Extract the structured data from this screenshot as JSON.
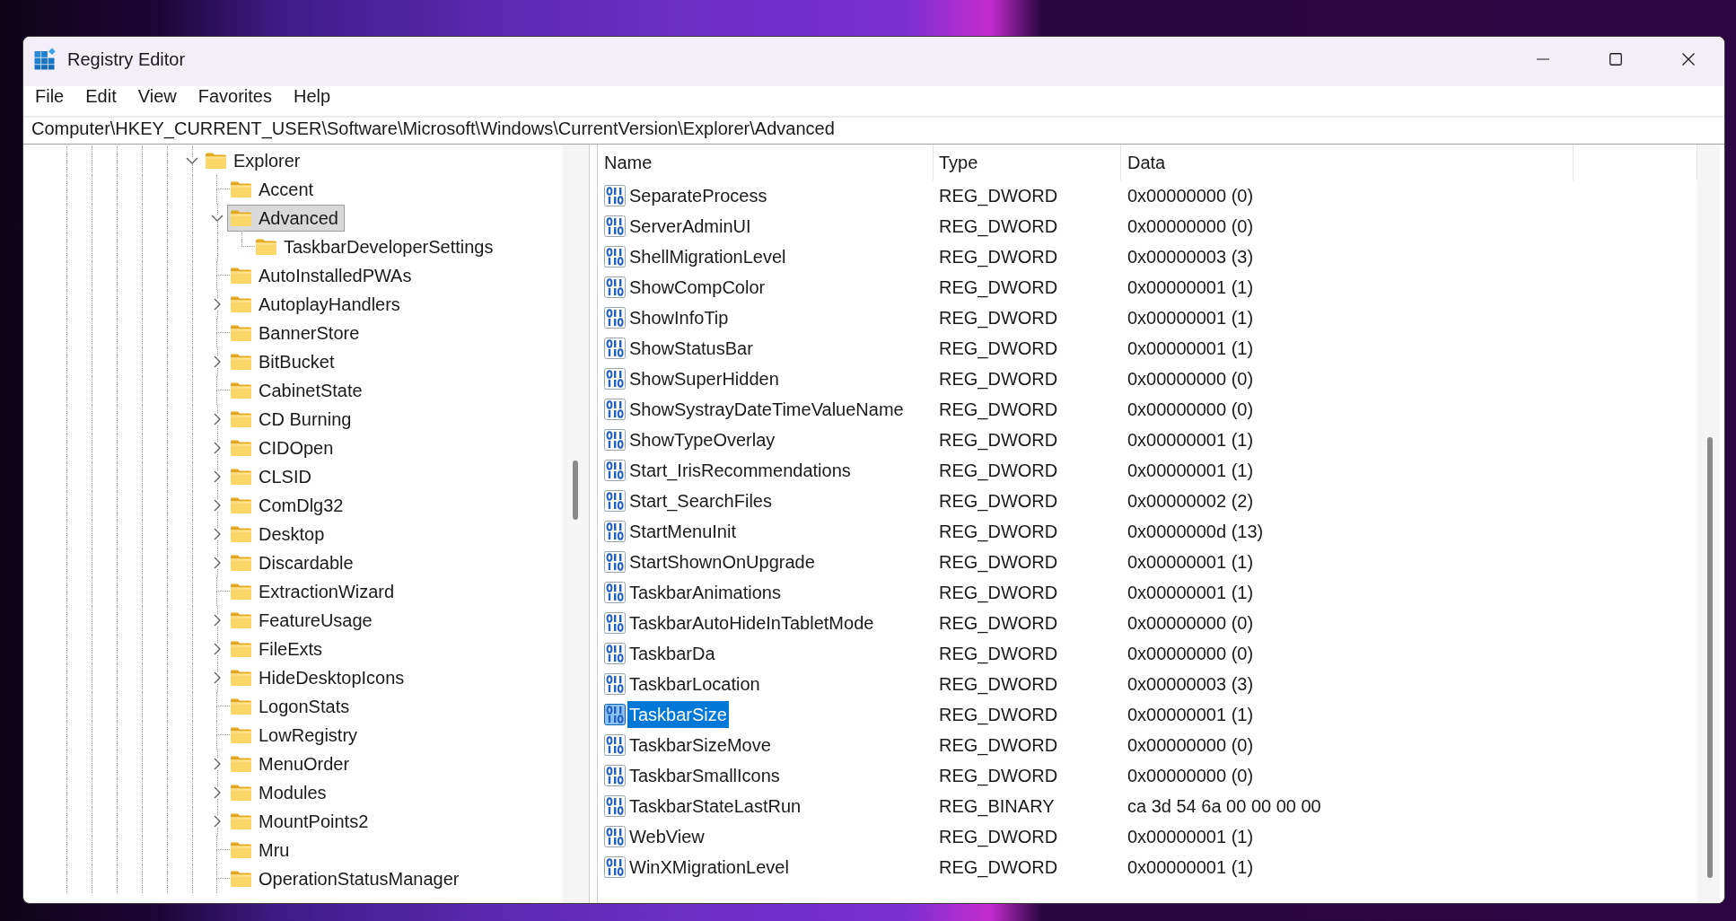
{
  "window": {
    "title": "Registry Editor"
  },
  "menu": [
    "File",
    "Edit",
    "View",
    "Favorites",
    "Help"
  ],
  "address_bar": {
    "value": "Computer\\HKEY_CURRENT_USER\\Software\\Microsoft\\Windows\\CurrentVersion\\Explorer\\Advanced"
  },
  "tree": {
    "items": [
      {
        "label": "Explorer",
        "kind": "branch",
        "expanded": true,
        "selected": false,
        "children": [
          {
            "label": "Accent",
            "kind": "leaf",
            "expanded": false,
            "selected": false
          },
          {
            "label": "Advanced",
            "kind": "branch",
            "expanded": true,
            "selected": true,
            "children": [
              {
                "label": "TaskbarDeveloperSettings",
                "kind": "leaf",
                "expanded": false,
                "selected": false
              }
            ]
          },
          {
            "label": "AutoInstalledPWAs",
            "kind": "leaf",
            "expanded": false,
            "selected": false
          },
          {
            "label": "AutoplayHandlers",
            "kind": "branch",
            "expanded": false,
            "selected": false
          },
          {
            "label": "BannerStore",
            "kind": "leaf",
            "expanded": false,
            "selected": false
          },
          {
            "label": "BitBucket",
            "kind": "branch",
            "expanded": false,
            "selected": false
          },
          {
            "label": "CabinetState",
            "kind": "leaf",
            "expanded": false,
            "selected": false
          },
          {
            "label": "CD Burning",
            "kind": "branch",
            "expanded": false,
            "selected": false
          },
          {
            "label": "CIDOpen",
            "kind": "branch",
            "expanded": false,
            "selected": false
          },
          {
            "label": "CLSID",
            "kind": "branch",
            "expanded": false,
            "selected": false
          },
          {
            "label": "ComDlg32",
            "kind": "branch",
            "expanded": false,
            "selected": false
          },
          {
            "label": "Desktop",
            "kind": "branch",
            "expanded": false,
            "selected": false
          },
          {
            "label": "Discardable",
            "kind": "branch",
            "expanded": false,
            "selected": false
          },
          {
            "label": "ExtractionWizard",
            "kind": "leaf",
            "expanded": false,
            "selected": false
          },
          {
            "label": "FeatureUsage",
            "kind": "branch",
            "expanded": false,
            "selected": false
          },
          {
            "label": "FileExts",
            "kind": "branch",
            "expanded": false,
            "selected": false
          },
          {
            "label": "HideDesktopIcons",
            "kind": "branch",
            "expanded": false,
            "selected": false
          },
          {
            "label": "LogonStats",
            "kind": "leaf",
            "expanded": false,
            "selected": false
          },
          {
            "label": "LowRegistry",
            "kind": "leaf",
            "expanded": false,
            "selected": false
          },
          {
            "label": "MenuOrder",
            "kind": "branch",
            "expanded": false,
            "selected": false
          },
          {
            "label": "Modules",
            "kind": "branch",
            "expanded": false,
            "selected": false
          },
          {
            "label": "MountPoints2",
            "kind": "branch",
            "expanded": false,
            "selected": false
          },
          {
            "label": "Mru",
            "kind": "leaf",
            "expanded": false,
            "selected": false
          },
          {
            "label": "OperationStatusManager",
            "kind": "leaf",
            "expanded": false,
            "selected": false
          }
        ]
      }
    ]
  },
  "values_table": {
    "columns": [
      "Name",
      "Type",
      "Data"
    ],
    "rows": [
      {
        "name": "SeparateProcess",
        "type": "REG_DWORD",
        "data": "0x00000000 (0)",
        "selected": false
      },
      {
        "name": "ServerAdminUI",
        "type": "REG_DWORD",
        "data": "0x00000000 (0)",
        "selected": false
      },
      {
        "name": "ShellMigrationLevel",
        "type": "REG_DWORD",
        "data": "0x00000003 (3)",
        "selected": false
      },
      {
        "name": "ShowCompColor",
        "type": "REG_DWORD",
        "data": "0x00000001 (1)",
        "selected": false
      },
      {
        "name": "ShowInfoTip",
        "type": "REG_DWORD",
        "data": "0x00000001 (1)",
        "selected": false
      },
      {
        "name": "ShowStatusBar",
        "type": "REG_DWORD",
        "data": "0x00000001 (1)",
        "selected": false
      },
      {
        "name": "ShowSuperHidden",
        "type": "REG_DWORD",
        "data": "0x00000000 (0)",
        "selected": false
      },
      {
        "name": "ShowSystrayDateTimeValueName",
        "type": "REG_DWORD",
        "data": "0x00000000 (0)",
        "selected": false
      },
      {
        "name": "ShowTypeOverlay",
        "type": "REG_DWORD",
        "data": "0x00000001 (1)",
        "selected": false
      },
      {
        "name": "Start_IrisRecommendations",
        "type": "REG_DWORD",
        "data": "0x00000001 (1)",
        "selected": false
      },
      {
        "name": "Start_SearchFiles",
        "type": "REG_DWORD",
        "data": "0x00000002 (2)",
        "selected": false
      },
      {
        "name": "StartMenuInit",
        "type": "REG_DWORD",
        "data": "0x0000000d (13)",
        "selected": false
      },
      {
        "name": "StartShownOnUpgrade",
        "type": "REG_DWORD",
        "data": "0x00000001 (1)",
        "selected": false
      },
      {
        "name": "TaskbarAnimations",
        "type": "REG_DWORD",
        "data": "0x00000001 (1)",
        "selected": false
      },
      {
        "name": "TaskbarAutoHideInTabletMode",
        "type": "REG_DWORD",
        "data": "0x00000000 (0)",
        "selected": false
      },
      {
        "name": "TaskbarDa",
        "type": "REG_DWORD",
        "data": "0x00000000 (0)",
        "selected": false
      },
      {
        "name": "TaskbarLocation",
        "type": "REG_DWORD",
        "data": "0x00000003 (3)",
        "selected": false
      },
      {
        "name": "TaskbarSize",
        "type": "REG_DWORD",
        "data": "0x00000001 (1)",
        "selected": true
      },
      {
        "name": "TaskbarSizeMove",
        "type": "REG_DWORD",
        "data": "0x00000000 (0)",
        "selected": false
      },
      {
        "name": "TaskbarSmallIcons",
        "type": "REG_DWORD",
        "data": "0x00000000 (0)",
        "selected": false
      },
      {
        "name": "TaskbarStateLastRun",
        "type": "REG_BINARY",
        "data": "ca 3d 54 6a 00 00 00 00",
        "selected": false
      },
      {
        "name": "WebView",
        "type": "REG_DWORD",
        "data": "0x00000001 (1)",
        "selected": false
      },
      {
        "name": "WinXMigrationLevel",
        "type": "REG_DWORD",
        "data": "0x00000001 (1)",
        "selected": false
      }
    ]
  }
}
